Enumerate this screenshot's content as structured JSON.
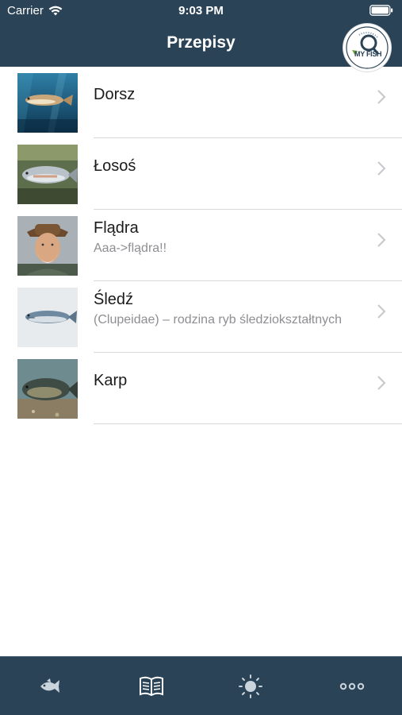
{
  "status_bar": {
    "carrier": "Carrier",
    "time": "9:03 PM"
  },
  "nav": {
    "title": "Przepisy",
    "logo_text": "MY FISH"
  },
  "recipes": [
    {
      "name": "Dorsz",
      "subtitle": "",
      "thumbnail": "cod-underwater-photo"
    },
    {
      "name": "Łosoś",
      "subtitle": "",
      "thumbnail": "salmon-photo"
    },
    {
      "name": "Flądra",
      "subtitle": "Aaa->flądra!!",
      "thumbnail": "old-man-portrait-photo"
    },
    {
      "name": "Śledź",
      "subtitle": "(Clupeidae) – rodzina ryb śledziokształtnych",
      "thumbnail": "herring-photo"
    },
    {
      "name": "Karp",
      "subtitle": "",
      "thumbnail": "carp-photo"
    }
  ],
  "tab_bar": {
    "tabs": [
      {
        "icon": "fish-icon",
        "active": false
      },
      {
        "icon": "book-icon",
        "active": true
      },
      {
        "icon": "sun-icon",
        "active": false
      },
      {
        "icon": "more-icon",
        "active": false
      }
    ]
  },
  "colors": {
    "bar_background": "#2b4356",
    "tab_active": "#ffffff",
    "tab_inactive": "#c9d3dc"
  }
}
